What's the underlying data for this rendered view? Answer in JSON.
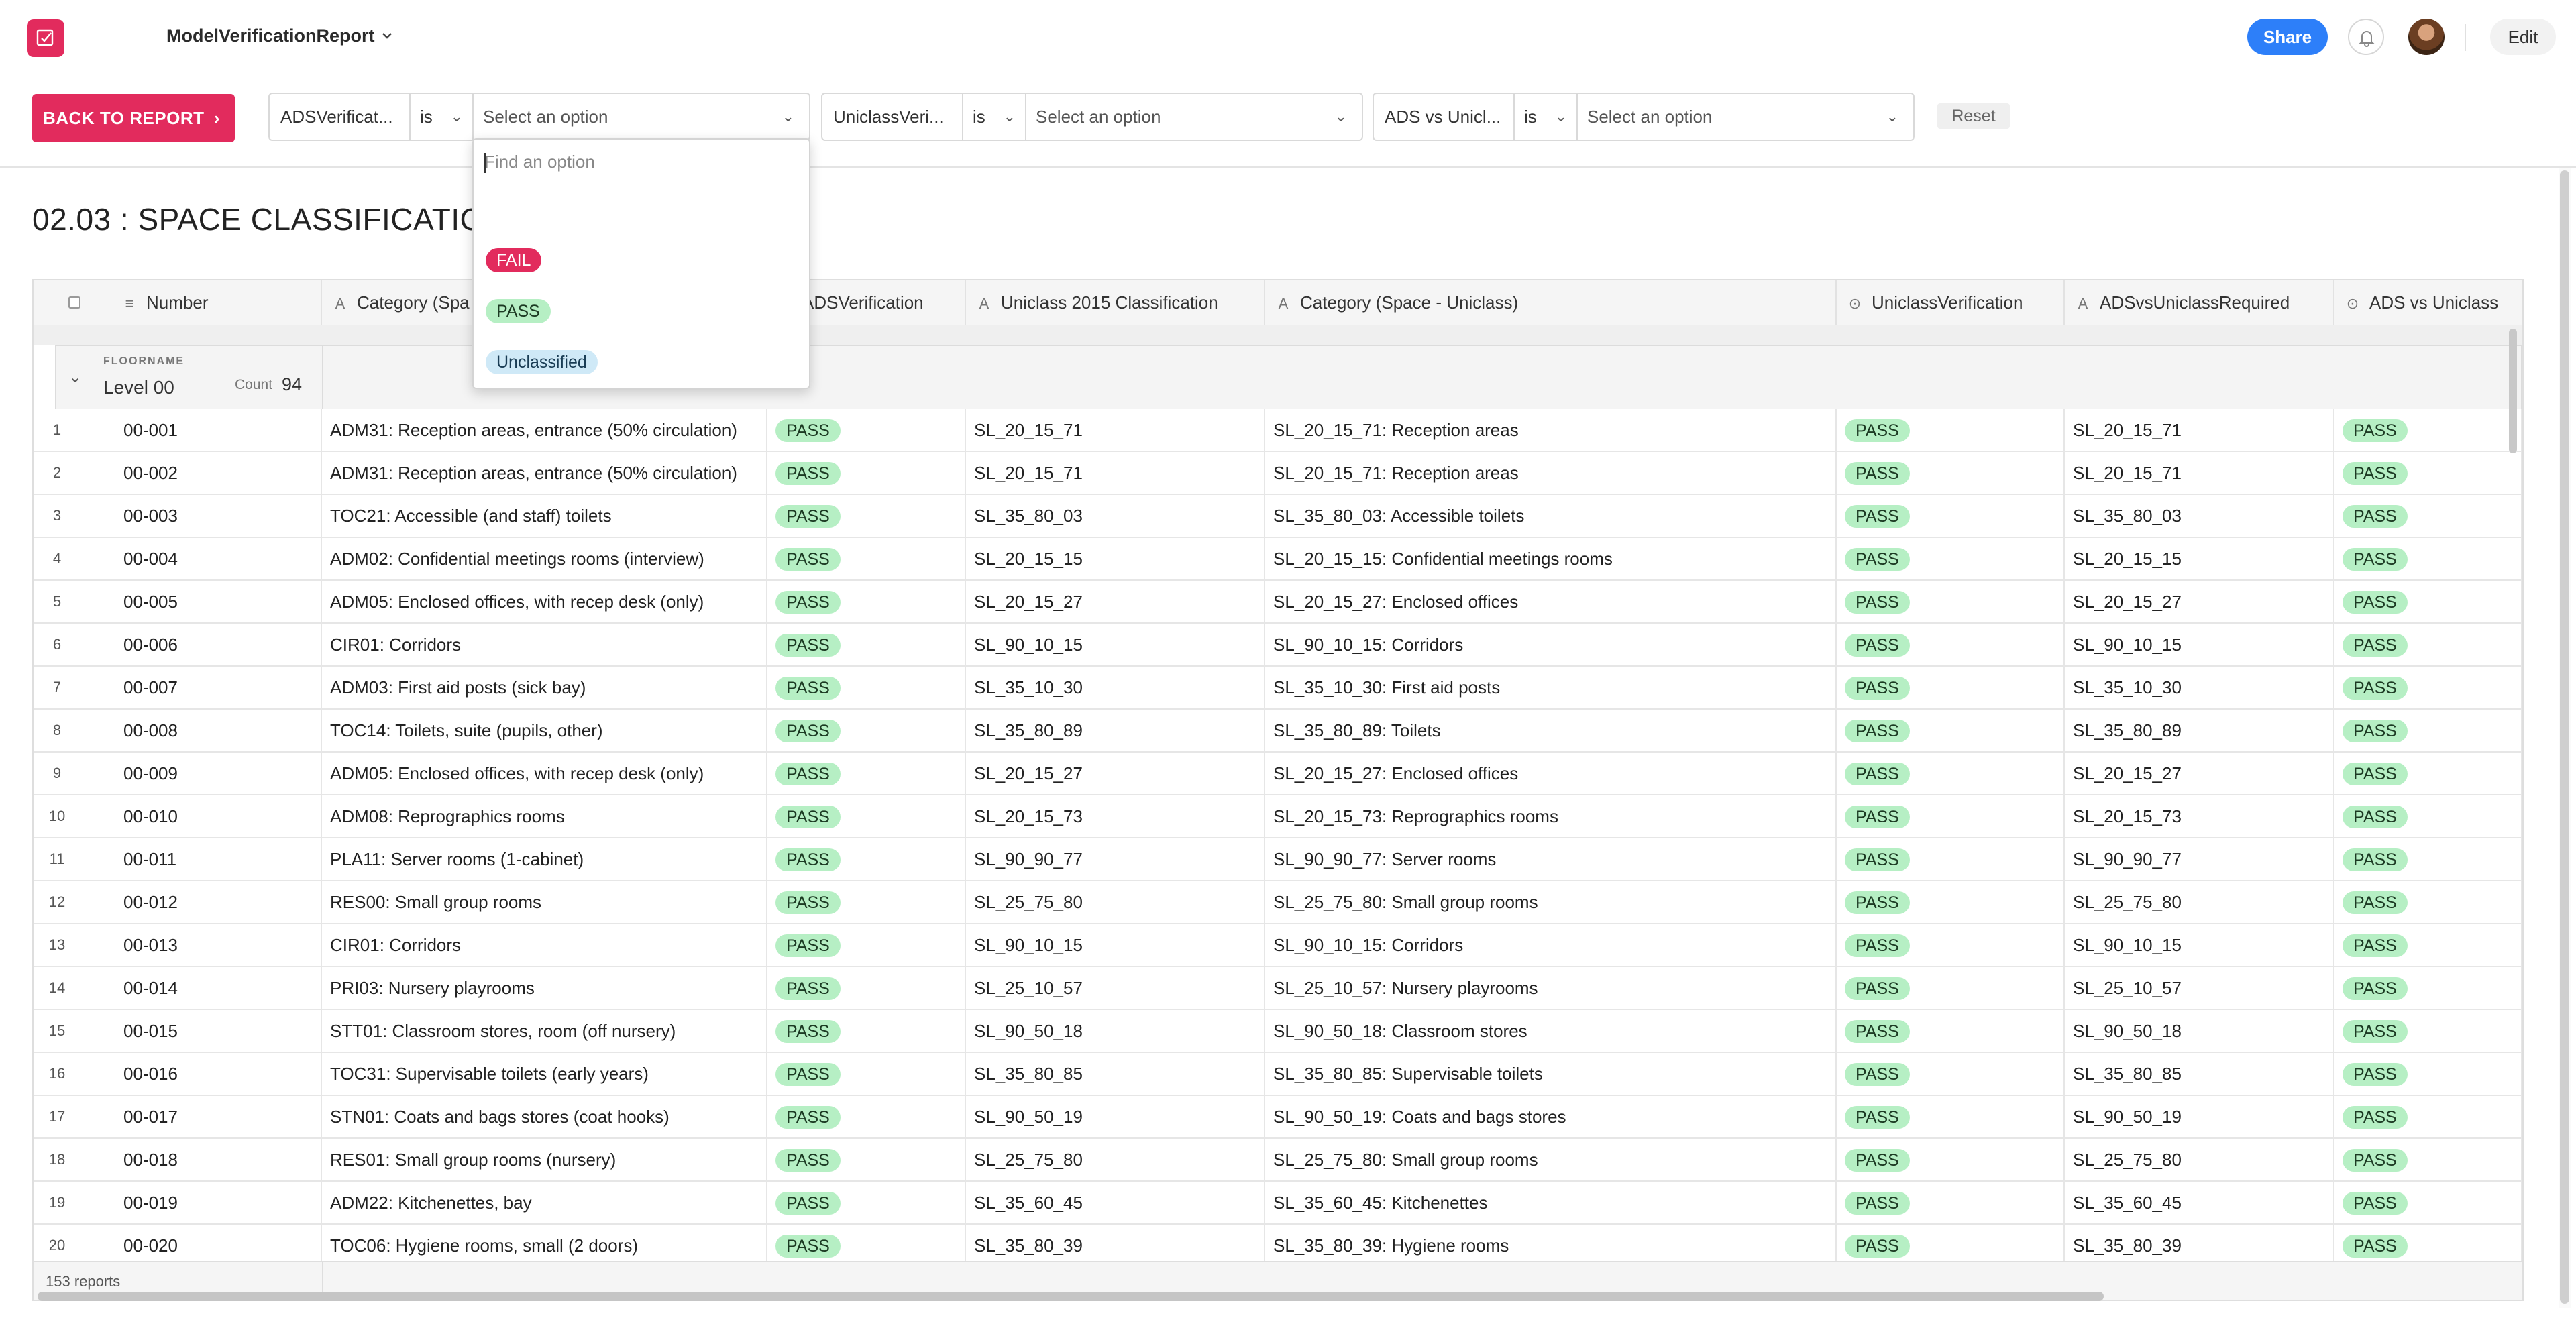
{
  "app": {
    "title": "ModelVerificationReport"
  },
  "header": {
    "share_label": "Share",
    "edit_label": "Edit"
  },
  "filterbar": {
    "back_label": "BACK TO REPORT",
    "reset_label": "Reset",
    "filters": [
      {
        "field": "ADSVerificat...",
        "operator": "is",
        "placeholder": "Select an option"
      },
      {
        "field": "UniclassVeri...",
        "operator": "is",
        "placeholder": "Select an option"
      },
      {
        "field": "ADS vs Unicl...",
        "operator": "is",
        "placeholder": "Select an option"
      }
    ]
  },
  "dropdown": {
    "search_placeholder": "Find an option",
    "options": [
      {
        "label": "FAIL",
        "color": "#e22b5d",
        "text_color": "#ffffff"
      },
      {
        "label": "PASS",
        "color": "#b6efc4",
        "text_color": "#1c3a23"
      },
      {
        "label": "Unclassified",
        "color": "#cfe9f7",
        "text_color": "#1a3d55"
      }
    ]
  },
  "page": {
    "title": "02.03 : SPACE CLASSIFICATIO"
  },
  "table": {
    "columns": [
      "Number",
      "Category (Spa",
      "ADSVerification",
      "Uniclass 2015 Classification",
      "Category (Space - Uniclass)",
      "UniclassVerification",
      "ADSvsUniclassRequired",
      "ADS vs Uniclass"
    ],
    "group": {
      "label": "FLOORNAME",
      "value": "Level 00",
      "count_label": "Count",
      "count": "94"
    },
    "rows": [
      {
        "n": "1",
        "number": "00-001",
        "category": "ADM31: Reception areas, entrance (50% circulation)",
        "ads": "PASS",
        "uniclass": "SL_20_15_71",
        "cat_uniclass": "SL_20_15_71: Reception areas",
        "uv": "PASS",
        "req": "SL_20_15_71",
        "avu": "PASS"
      },
      {
        "n": "2",
        "number": "00-002",
        "category": "ADM31: Reception areas, entrance (50% circulation)",
        "ads": "PASS",
        "uniclass": "SL_20_15_71",
        "cat_uniclass": "SL_20_15_71: Reception areas",
        "uv": "PASS",
        "req": "SL_20_15_71",
        "avu": "PASS"
      },
      {
        "n": "3",
        "number": "00-003",
        "category": "TOC21: Accessible (and staff) toilets",
        "ads": "PASS",
        "uniclass": "SL_35_80_03",
        "cat_uniclass": "SL_35_80_03: Accessible toilets",
        "uv": "PASS",
        "req": "SL_35_80_03",
        "avu": "PASS"
      },
      {
        "n": "4",
        "number": "00-004",
        "category": "ADM02: Confidential meetings rooms (interview)",
        "ads": "PASS",
        "uniclass": "SL_20_15_15",
        "cat_uniclass": "SL_20_15_15: Confidential meetings rooms",
        "uv": "PASS",
        "req": "SL_20_15_15",
        "avu": "PASS"
      },
      {
        "n": "5",
        "number": "00-005",
        "category": "ADM05: Enclosed offices, with recep desk (only)",
        "ads": "PASS",
        "uniclass": "SL_20_15_27",
        "cat_uniclass": "SL_20_15_27: Enclosed offices",
        "uv": "PASS",
        "req": "SL_20_15_27",
        "avu": "PASS"
      },
      {
        "n": "6",
        "number": "00-006",
        "category": "CIR01: Corridors",
        "ads": "PASS",
        "uniclass": "SL_90_10_15",
        "cat_uniclass": "SL_90_10_15: Corridors",
        "uv": "PASS",
        "req": "SL_90_10_15",
        "avu": "PASS"
      },
      {
        "n": "7",
        "number": "00-007",
        "category": "ADM03: First aid posts (sick bay)",
        "ads": "PASS",
        "uniclass": "SL_35_10_30",
        "cat_uniclass": "SL_35_10_30: First aid posts",
        "uv": "PASS",
        "req": "SL_35_10_30",
        "avu": "PASS"
      },
      {
        "n": "8",
        "number": "00-008",
        "category": "TOC14: Toilets, suite (pupils, other)",
        "ads": "PASS",
        "uniclass": "SL_35_80_89",
        "cat_uniclass": "SL_35_80_89: Toilets",
        "uv": "PASS",
        "req": "SL_35_80_89",
        "avu": "PASS"
      },
      {
        "n": "9",
        "number": "00-009",
        "category": "ADM05: Enclosed offices, with recep desk (only)",
        "ads": "PASS",
        "uniclass": "SL_20_15_27",
        "cat_uniclass": "SL_20_15_27: Enclosed offices",
        "uv": "PASS",
        "req": "SL_20_15_27",
        "avu": "PASS"
      },
      {
        "n": "10",
        "number": "00-010",
        "category": "ADM08: Reprographics rooms",
        "ads": "PASS",
        "uniclass": "SL_20_15_73",
        "cat_uniclass": "SL_20_15_73: Reprographics rooms",
        "uv": "PASS",
        "req": "SL_20_15_73",
        "avu": "PASS"
      },
      {
        "n": "11",
        "number": "00-011",
        "category": "PLA11: Server rooms (1-cabinet)",
        "ads": "PASS",
        "uniclass": "SL_90_90_77",
        "cat_uniclass": "SL_90_90_77: Server rooms",
        "uv": "PASS",
        "req": "SL_90_90_77",
        "avu": "PASS"
      },
      {
        "n": "12",
        "number": "00-012",
        "category": "RES00: Small group rooms",
        "ads": "PASS",
        "uniclass": "SL_25_75_80",
        "cat_uniclass": "SL_25_75_80: Small group rooms",
        "uv": "PASS",
        "req": "SL_25_75_80",
        "avu": "PASS"
      },
      {
        "n": "13",
        "number": "00-013",
        "category": "CIR01: Corridors",
        "ads": "PASS",
        "uniclass": "SL_90_10_15",
        "cat_uniclass": "SL_90_10_15: Corridors",
        "uv": "PASS",
        "req": "SL_90_10_15",
        "avu": "PASS"
      },
      {
        "n": "14",
        "number": "00-014",
        "category": "PRI03: Nursery playrooms",
        "ads": "PASS",
        "uniclass": "SL_25_10_57",
        "cat_uniclass": "SL_25_10_57: Nursery playrooms",
        "uv": "PASS",
        "req": "SL_25_10_57",
        "avu": "PASS"
      },
      {
        "n": "15",
        "number": "00-015",
        "category": "STT01: Classroom stores, room (off nursery)",
        "ads": "PASS",
        "uniclass": "SL_90_50_18",
        "cat_uniclass": "SL_90_50_18: Classroom stores",
        "uv": "PASS",
        "req": "SL_90_50_18",
        "avu": "PASS"
      },
      {
        "n": "16",
        "number": "00-016",
        "category": "TOC31: Supervisable toilets (early years)",
        "ads": "PASS",
        "uniclass": "SL_35_80_85",
        "cat_uniclass": "SL_35_80_85: Supervisable toilets",
        "uv": "PASS",
        "req": "SL_35_80_85",
        "avu": "PASS"
      },
      {
        "n": "17",
        "number": "00-017",
        "category": "STN01: Coats and bags stores (coat hooks)",
        "ads": "PASS",
        "uniclass": "SL_90_50_19",
        "cat_uniclass": "SL_90_50_19: Coats and bags stores",
        "uv": "PASS",
        "req": "SL_90_50_19",
        "avu": "PASS"
      },
      {
        "n": "18",
        "number": "00-018",
        "category": "RES01: Small group rooms (nursery)",
        "ads": "PASS",
        "uniclass": "SL_25_75_80",
        "cat_uniclass": "SL_25_75_80: Small group rooms",
        "uv": "PASS",
        "req": "SL_25_75_80",
        "avu": "PASS"
      },
      {
        "n": "19",
        "number": "00-019",
        "category": "ADM22: Kitchenettes, bay",
        "ads": "PASS",
        "uniclass": "SL_35_60_45",
        "cat_uniclass": "SL_35_60_45: Kitchenettes",
        "uv": "PASS",
        "req": "SL_35_60_45",
        "avu": "PASS"
      },
      {
        "n": "20",
        "number": "00-020",
        "category": "TOC06: Hygiene rooms, small (2 doors)",
        "ads": "PASS",
        "uniclass": "SL_35_80_39",
        "cat_uniclass": "SL_35_80_39: Hygiene rooms",
        "uv": "PASS",
        "req": "SL_35_80_39",
        "avu": "PASS"
      }
    ],
    "footer_text": "153 reports"
  },
  "colors": {
    "brand": "#e22b5d",
    "share": "#2d7ff9",
    "pass_badge": "#b6efc4"
  }
}
